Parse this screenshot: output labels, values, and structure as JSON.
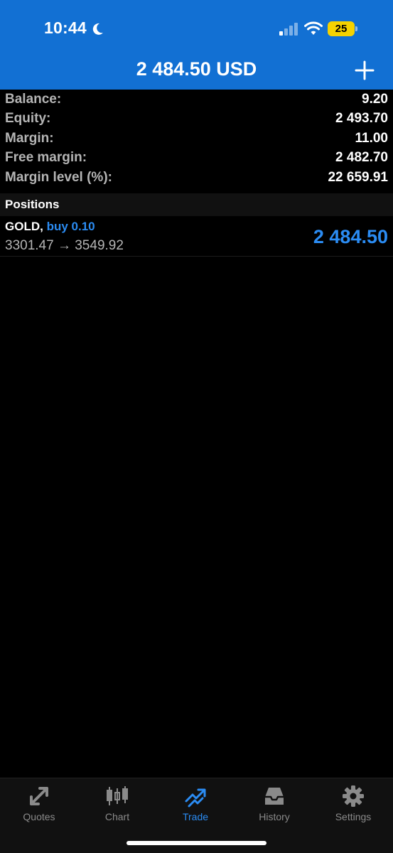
{
  "status_bar": {
    "time": "10:44",
    "battery": "25",
    "icons": [
      "moon-icon",
      "signal-icon",
      "wifi-icon",
      "battery-icon"
    ]
  },
  "header": {
    "title": "2 484.50 USD",
    "add_icon": "plus-icon",
    "background": "#1270d3"
  },
  "account": {
    "rows": [
      {
        "label": "Balance:",
        "value": "9.20"
      },
      {
        "label": "Equity:",
        "value": "2 493.70"
      },
      {
        "label": "Margin:",
        "value": "11.00"
      },
      {
        "label": "Free margin:",
        "value": "2 482.70"
      },
      {
        "label": "Margin level (%):",
        "value": "22 659.91"
      }
    ]
  },
  "positions": {
    "header": "Positions",
    "items": [
      {
        "symbol": "GOLD,",
        "type": "buy 0.10",
        "prices": "3301.47 → 3549.92",
        "profit": "2 484.50"
      }
    ]
  },
  "tabbar": {
    "tabs": [
      {
        "label": "Quotes",
        "icon": "quotes-icon"
      },
      {
        "label": "Chart",
        "icon": "chart-icon"
      },
      {
        "label": "Trade",
        "icon": "trade-icon",
        "active": true
      },
      {
        "label": "History",
        "icon": "history-icon"
      },
      {
        "label": "Settings",
        "icon": "settings-icon"
      }
    ]
  },
  "colors": {
    "accent": "#2b8cf3",
    "label_gray": "#b5b5b5",
    "tab_gray": "#8a8a8a"
  }
}
